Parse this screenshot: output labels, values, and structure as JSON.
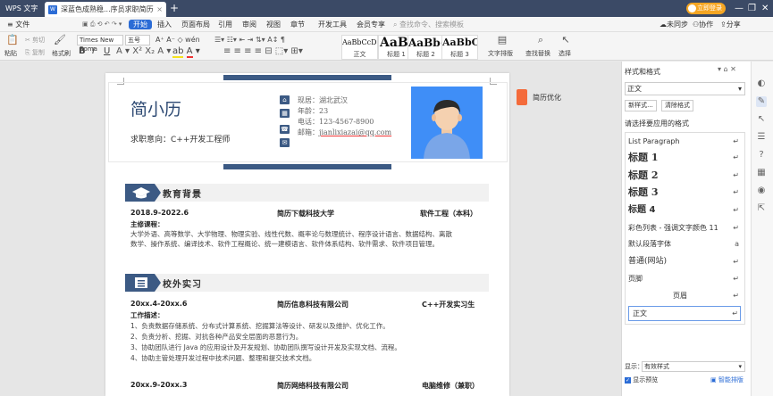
{
  "titlebar": {
    "app_tab": "WPS 文字",
    "doc_tab": "深蓝色成熟稳...序员求职简历",
    "doc_badge": "W",
    "close": "×",
    "new_tab": "+",
    "login": "立即登录",
    "min": "—",
    "max": "❐",
    "close_win": "✕"
  },
  "menubar": {
    "file": "≡ 文件",
    "items": [
      "开始",
      "插入",
      "页面布局",
      "引用",
      "审阅",
      "视图",
      "章节",
      "开发工具",
      "会员专享"
    ],
    "search": "查找命令、搜索模板",
    "unsynced": "未同步",
    "collab": "协作",
    "share": "分享"
  },
  "toolbar": {
    "paste": "粘贴",
    "cut": "剪切",
    "copy": "复制",
    "format_painter": "格式刷",
    "font_name": "Times New Roma",
    "font_size": "五号",
    "styles": [
      {
        "sample": "AaBbCcDd",
        "label": "正文"
      },
      {
        "sample": "AaBl",
        "label": "标题 1"
      },
      {
        "sample": "AaBb(",
        "label": "标题 2"
      },
      {
        "sample": "AaBbC",
        "label": "标题 3"
      }
    ],
    "text_layout": "文字排版",
    "find_replace": "查找替换",
    "select": "选择"
  },
  "resume": {
    "name": "简小历",
    "intent": "求职意向：C++开发工程师",
    "contacts": [
      {
        "icon": "home-icon",
        "text": "现居：湖北武汉"
      },
      {
        "icon": "calendar-icon",
        "text": "年龄：23"
      },
      {
        "icon": "phone-icon",
        "text": "电话：123-4567-8900"
      },
      {
        "icon": "mail-icon",
        "label": "邮箱：",
        "text": "jianlixiazai@qq.com"
      }
    ],
    "education": {
      "title": "教育背景",
      "date": "2018.9-2022.6",
      "school": "简历下载科技大学",
      "major": "软件工程（本科）",
      "courses_label": "主修课程：",
      "courses_1": "大学外语、高等数学、大学物理、物理实验、线性代数、概率论与数理统计、程序设计语言、数据结构、离散",
      "courses_2": "数学、操作系统、编译技术、软件工程概论、统一建模语言、软件体系结构、软件需求、软件项目管理。"
    },
    "internship": {
      "title": "校外实习",
      "date": "20xx.4-20xx.6",
      "company": "简历信息科技有限公司",
      "position": "C++开发实习生",
      "desc_label": "工作描述：",
      "items": [
        "1、负责数据存储系统、分布式计算系统、挖掘算法等设计、研发以及维护、优化工作。",
        "2、负责分析、挖掘、对抗各种产品安全层面的恶意行为。",
        "3、协助团队进行 Java 的应用设计及开发规划、协助团队撰写设计开发及实现文档、流程。",
        "4、协助主管处理开发过程中技术问题、整理和提交技术文档。"
      ],
      "date2": "20xx.9-20xx.3",
      "company2": "简历网络科技有限公司",
      "position2": "电脑维修（兼职）"
    },
    "optimize": "简历优化"
  },
  "panel": {
    "title": "样式和格式",
    "current_style": "正文",
    "new_style": "新样式...",
    "clear_format": "清除格式",
    "prompt": "请选择要应用的格式",
    "styles": [
      {
        "label": "List Paragraph",
        "mark": "↵"
      },
      {
        "label": "标题 1",
        "mark": "↵"
      },
      {
        "label": "标题 2",
        "mark": "↵"
      },
      {
        "label": "标题 3",
        "mark": "↵"
      },
      {
        "label": "标题 4",
        "mark": "↵"
      },
      {
        "label": "彩色列表 - 强调文字颜色 11",
        "mark": "↵"
      },
      {
        "label": "默认段落字体",
        "mark": "a"
      },
      {
        "label": "普通(网站)",
        "mark": "↵"
      },
      {
        "label": "页脚",
        "mark": "↵"
      },
      {
        "label": "页眉",
        "mark": "↵"
      },
      {
        "label": "正文",
        "mark": "↵"
      }
    ],
    "display_label": "显示：",
    "display_value": "有效样式",
    "preview": "显示预览",
    "smart_layout": "智能排版"
  }
}
